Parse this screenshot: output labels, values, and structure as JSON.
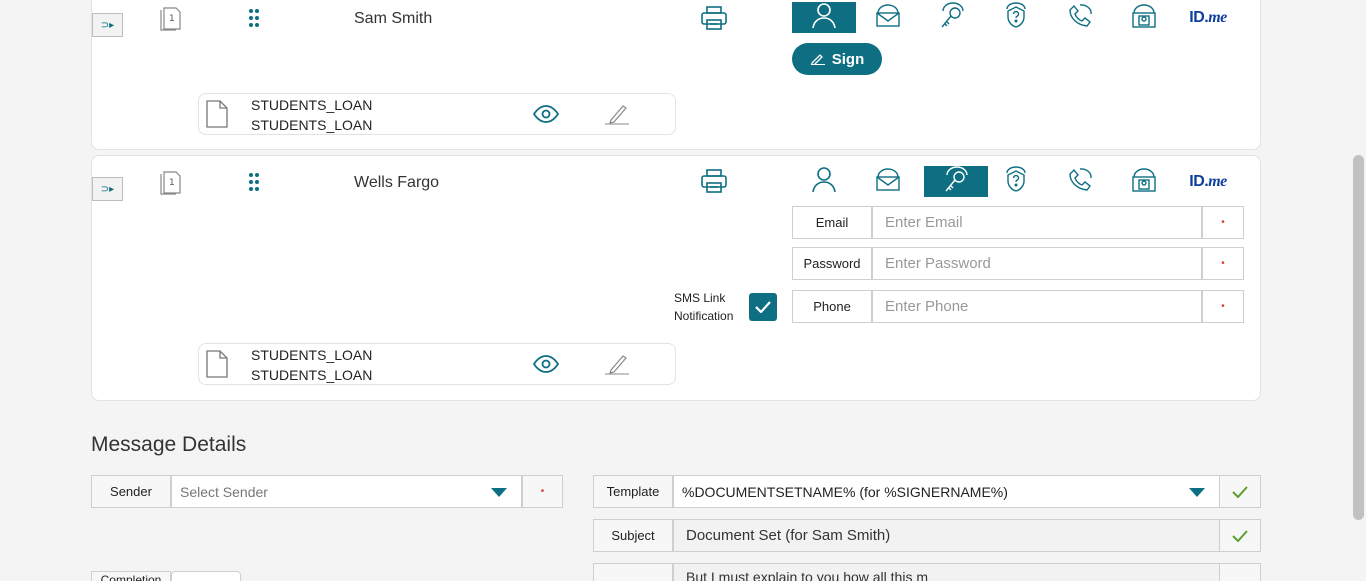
{
  "signers": [
    {
      "name": "Sam Smith",
      "page_number": "1",
      "documents": [
        "STUDENTS_LOAN",
        "STUDENTS_LOAN"
      ],
      "sign_button": "Sign",
      "idme_label": "ID.",
      "idme_suffix": "me"
    },
    {
      "name": "Wells Fargo",
      "page_number": "1",
      "documents": [
        "STUDENTS_LOAN",
        "STUDENTS_LOAN"
      ],
      "idme_label": "ID.",
      "idme_suffix": "me",
      "sms_label_line1": "SMS Link",
      "sms_label_line2": "Notification",
      "sms_checked": true,
      "fields": {
        "email_label": "Email",
        "email_placeholder": "Enter Email",
        "password_label": "Password",
        "password_placeholder": "Enter Password",
        "phone_label": "Phone",
        "phone_placeholder": "Enter Phone"
      }
    }
  ],
  "message_details": {
    "title": "Message Details",
    "sender_label": "Sender",
    "sender_placeholder": "Select Sender",
    "template_label": "Template",
    "template_value": "%DOCUMENTSETNAME% (for %SIGNERNAME%)",
    "subject_label": "Subject",
    "subject_value": "Document Set (for Sam Smith)",
    "completion_label": "Completion",
    "body_preview": "But I must explain to you how all this m"
  },
  "colors": {
    "accent": "#0e6f82",
    "idme": "#0f3f9e",
    "required": "#e23a3a",
    "check": "#5aa02c"
  }
}
